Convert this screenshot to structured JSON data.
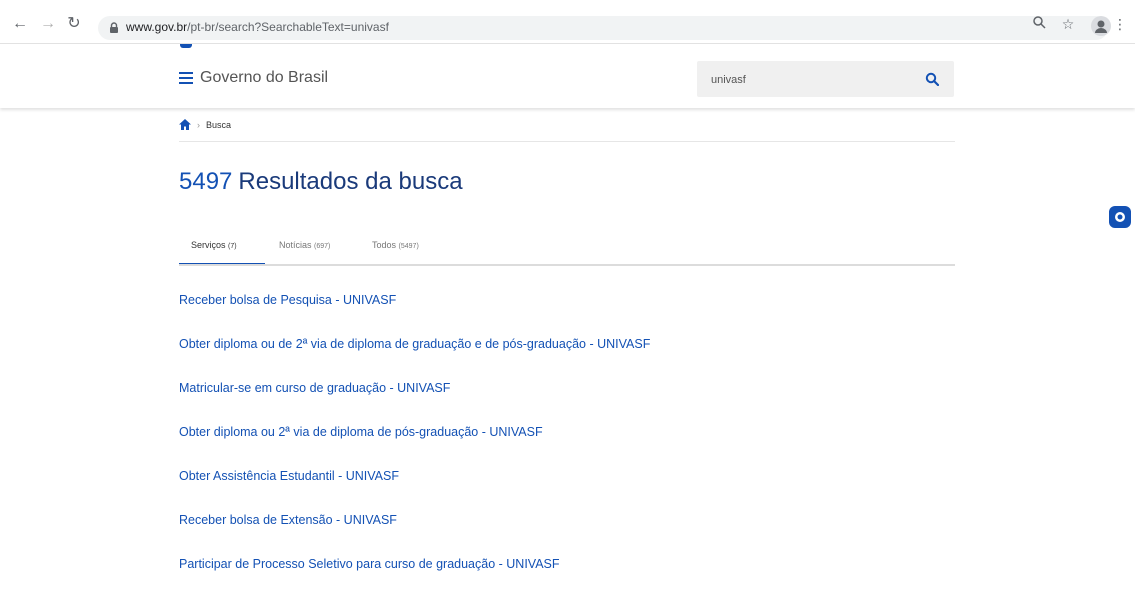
{
  "browser": {
    "url_host": "www.gov.br",
    "url_path": "/pt-br/search?SearchableText=univasf"
  },
  "header": {
    "title": "Governo do Brasil",
    "search_value": "univasf"
  },
  "breadcrumb": {
    "current": "Busca"
  },
  "results_header": {
    "count": "5497",
    "label": "Resultados da busca"
  },
  "tabs": [
    {
      "label": "Serviços",
      "count": "(7)",
      "active": true
    },
    {
      "label": "Notícias",
      "count": "(697)",
      "active": false
    },
    {
      "label": "Todos",
      "count": "(5497)",
      "active": false
    }
  ],
  "results": [
    "Receber bolsa de Pesquisa - UNIVASF",
    "Obter diploma ou de 2ª via de diploma de graduação e de pós-graduação - UNIVASF",
    "Matricular-se em curso de graduação - UNIVASF",
    "Obter diploma ou 2ª via de diploma de pós-graduação - UNIVASF",
    "Obter Assistência Estudantil - UNIVASF",
    "Receber bolsa de Extensão - UNIVASF",
    "Participar de Processo Seletivo para curso de graduação - UNIVASF"
  ],
  "colors": {
    "primary": "#1351b4",
    "title": "#1a3a7a"
  }
}
